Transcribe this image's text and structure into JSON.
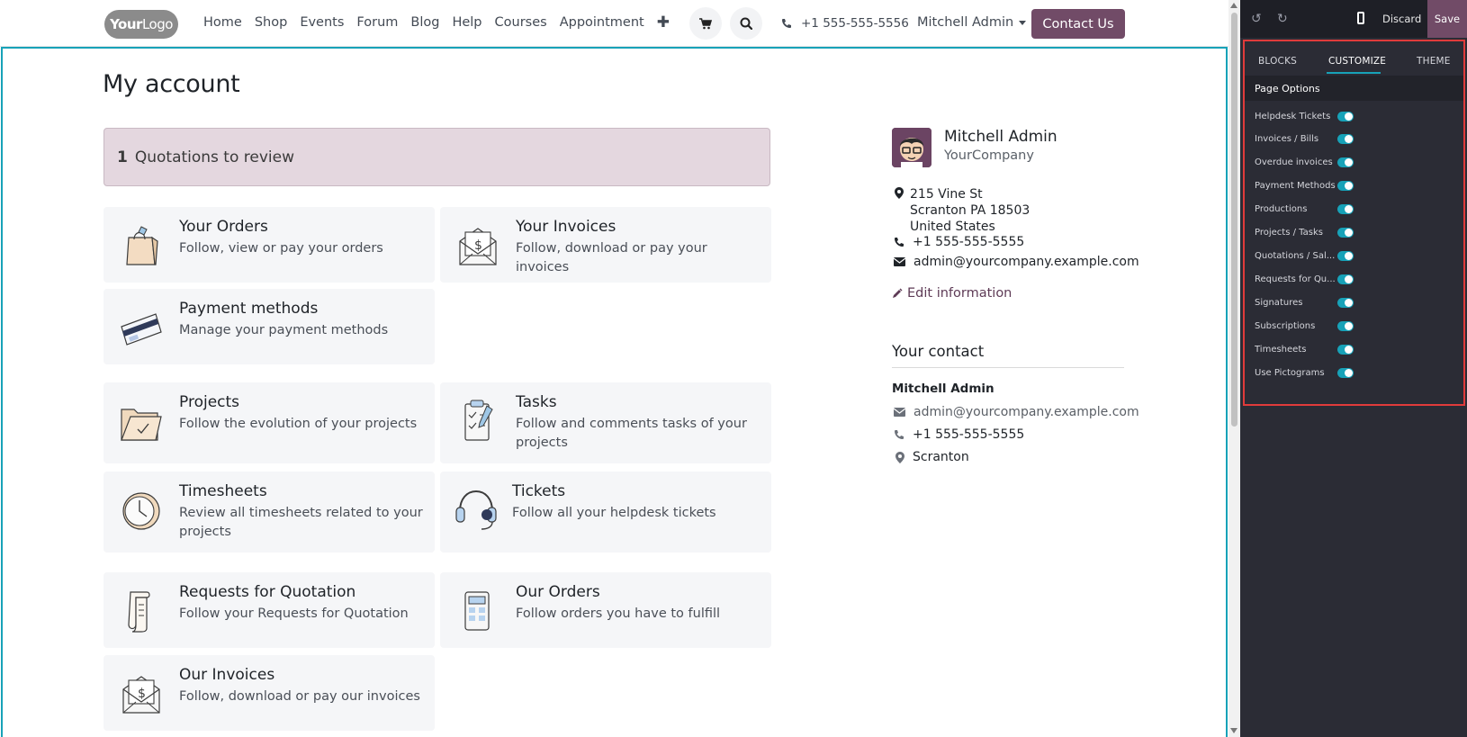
{
  "site": {
    "logo": {
      "bold": "Your",
      "rest": "Logo"
    },
    "menu": [
      "Home",
      "Shop",
      "Events",
      "Forum",
      "Blog",
      "Help",
      "Courses",
      "Appointment"
    ],
    "add_icon": "plus-icon",
    "phone": "+1 555-555-5556",
    "user": "Mitchell Admin",
    "contact_button": "Contact Us"
  },
  "page": {
    "title": "My account",
    "alert": {
      "count": "1",
      "text": "Quotations to review"
    }
  },
  "cards": [
    {
      "title": "Your Orders",
      "desc": "Follow, view or pay your orders",
      "icon": "shopping-bag-icon"
    },
    {
      "title": "Your Invoices",
      "desc": "Follow, download or pay your invoices",
      "icon": "invoice-envelope-icon"
    },
    {
      "title": "Payment methods",
      "desc": "Manage your payment methods",
      "icon": "credit-card-icon"
    },
    {
      "title": "Projects",
      "desc": "Follow the evolution of your projects",
      "icon": "folder-icon"
    },
    {
      "title": "Tasks",
      "desc": "Follow and comments tasks of your projects",
      "icon": "task-checklist-icon"
    },
    {
      "title": "Timesheets",
      "desc": "Review all timesheets related to your projects",
      "icon": "clock-icon"
    },
    {
      "title": "Tickets",
      "desc": "Follow all your helpdesk tickets",
      "icon": "headset-icon"
    },
    {
      "title": "Requests for Quotation",
      "desc": "Follow your Requests for Quotation",
      "icon": "scroll-icon"
    },
    {
      "title": "Our Orders",
      "desc": "Follow orders you have to fulfill",
      "icon": "calculator-icon"
    },
    {
      "title": "Our Invoices",
      "desc": "Follow, download or pay our invoices",
      "icon": "invoice-envelope-icon"
    }
  ],
  "profile": {
    "name": "Mitchell Admin",
    "company": "YourCompany",
    "address_line1": "215 Vine St",
    "address_line2": "Scranton PA 18503",
    "address_line3": "United States",
    "phone": "+1 555-555-5555",
    "email": "admin@yourcompany.example.com",
    "edit_label": "Edit information"
  },
  "your_contact": {
    "heading": "Your contact",
    "name": "Mitchell Admin",
    "email": "admin@yourcompany.example.com",
    "phone": "+1 555-555-5555",
    "city": "Scranton"
  },
  "editor": {
    "discard": "Discard",
    "save": "Save",
    "tabs": [
      "BLOCKS",
      "CUSTOMIZE",
      "THEME"
    ],
    "active_tab": "CUSTOMIZE",
    "section_title": "Page Options",
    "options": [
      {
        "label": "Helpdesk Tickets",
        "on": true
      },
      {
        "label": "Invoices / Bills",
        "on": true
      },
      {
        "label": "Overdue invoices",
        "on": true
      },
      {
        "label": "Payment Methods",
        "on": true
      },
      {
        "label": "Productions",
        "on": true
      },
      {
        "label": "Projects / Tasks",
        "on": true
      },
      {
        "label": "Quotations / Sal...",
        "on": true
      },
      {
        "label": "Requests for Qu...",
        "on": true
      },
      {
        "label": "Signatures",
        "on": true
      },
      {
        "label": "Subscriptions",
        "on": true
      },
      {
        "label": "Timesheets",
        "on": true
      },
      {
        "label": "Use Pictograms",
        "on": true
      }
    ],
    "colors": {
      "accent": "#17a2b8",
      "brand": "#714b67",
      "highlight": "#e03b3b"
    }
  }
}
